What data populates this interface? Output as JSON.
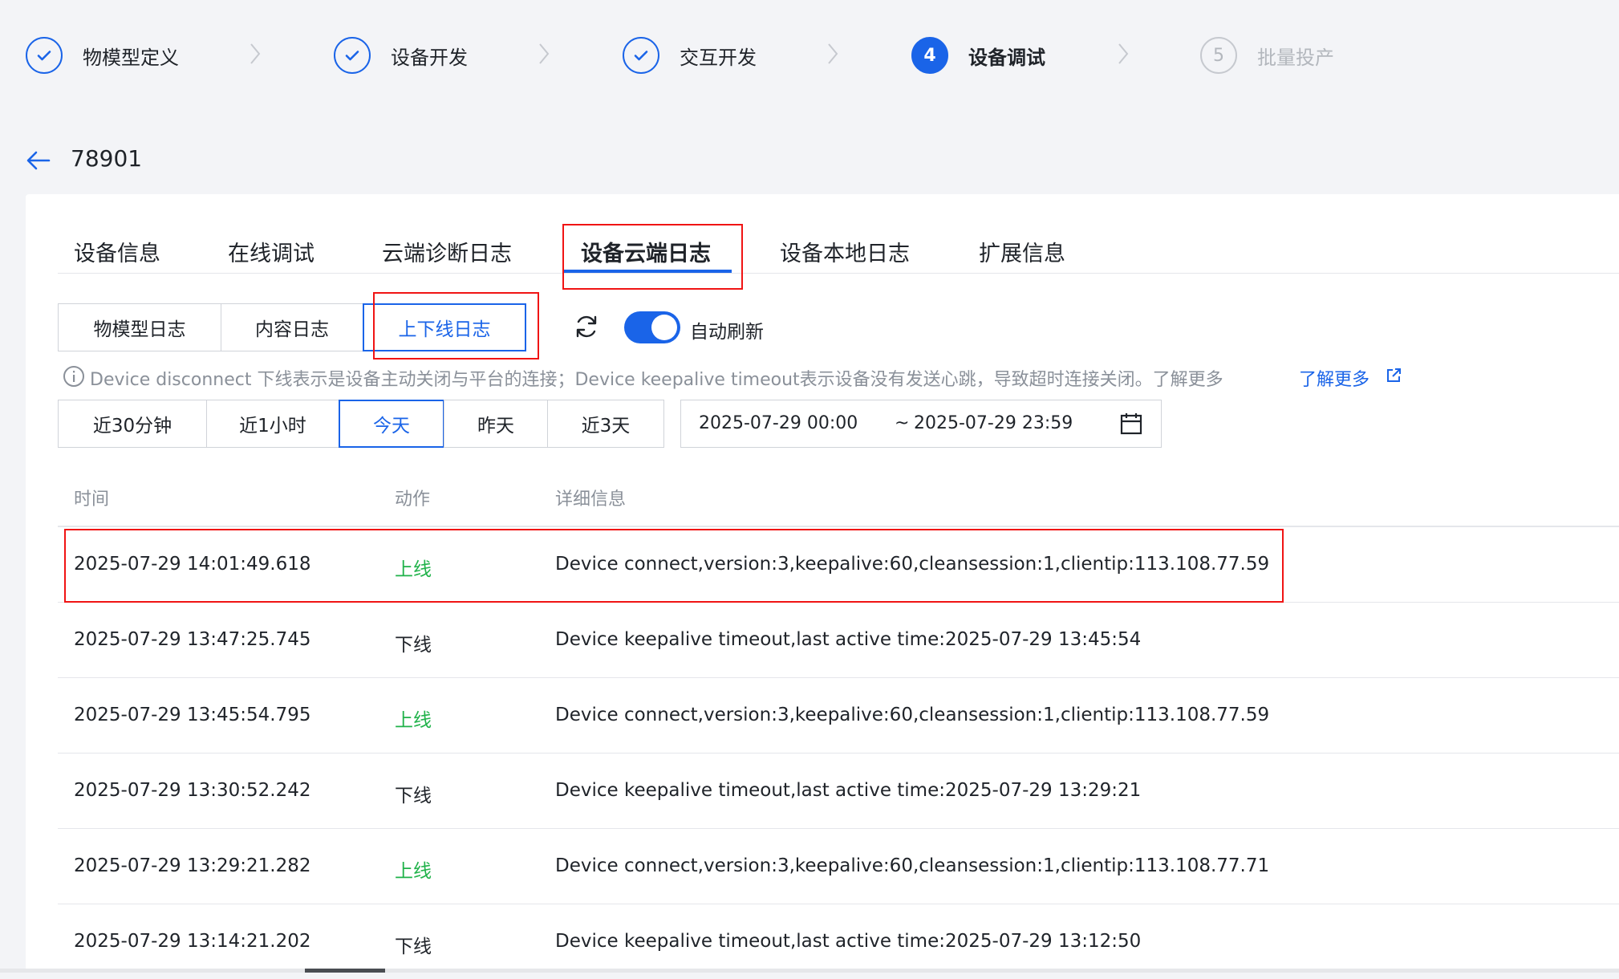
{
  "steps": [
    {
      "label": "物模型定义",
      "state": "done"
    },
    {
      "label": "设备开发",
      "state": "done"
    },
    {
      "label": "交互开发",
      "state": "done"
    },
    {
      "label": "设备调试",
      "state": "active",
      "number": "4"
    },
    {
      "label": "批量投产",
      "state": "pending",
      "number": "5"
    }
  ],
  "header": {
    "device_id": "78901"
  },
  "main_tabs": [
    {
      "label": "设备信息"
    },
    {
      "label": "在线调试"
    },
    {
      "label": "云端诊断日志"
    },
    {
      "label": "设备云端日志",
      "active": true
    },
    {
      "label": "设备本地日志"
    },
    {
      "label": "扩展信息"
    }
  ],
  "log_types": [
    {
      "label": "物模型日志"
    },
    {
      "label": "内容日志"
    },
    {
      "label": "上下线日志",
      "active": true
    }
  ],
  "auto_refresh": {
    "label": "自动刷新",
    "on": true
  },
  "info": {
    "text": "Device disconnect 下线表示是设备主动关闭与平台的连接；Device keepalive timeout表示设备没有发送心跳，导致超时连接关闭。了解更多",
    "link": "了解更多"
  },
  "time_ranges": [
    {
      "label": "近30分钟"
    },
    {
      "label": "近1小时"
    },
    {
      "label": "今天",
      "active": true
    },
    {
      "label": "昨天"
    },
    {
      "label": "近3天"
    }
  ],
  "date_range": {
    "start": "2025-07-29 00:00",
    "separator": "~",
    "end": "2025-07-29 23:59"
  },
  "table": {
    "columns": [
      "时间",
      "动作",
      "详细信息"
    ],
    "rows": [
      {
        "time": "2025-07-29 14:01:49.618",
        "action": "上线",
        "detail": "Device connect,version:3,keepalive:60,cleansession:1,clientip:113.108.77.59"
      },
      {
        "time": "2025-07-29 13:47:25.745",
        "action": "下线",
        "detail": "Device keepalive timeout,last active time:2025-07-29 13:45:54"
      },
      {
        "time": "2025-07-29 13:45:54.795",
        "action": "上线",
        "detail": "Device connect,version:3,keepalive:60,cleansession:1,clientip:113.108.77.59"
      },
      {
        "time": "2025-07-29 13:30:52.242",
        "action": "下线",
        "detail": "Device keepalive timeout,last active time:2025-07-29 13:29:21"
      },
      {
        "time": "2025-07-29 13:29:21.282",
        "action": "上线",
        "detail": "Device connect,version:3,keepalive:60,cleansession:1,clientip:113.108.77.71"
      },
      {
        "time": "2025-07-29 13:14:21.202",
        "action": "下线",
        "detail": "Device keepalive timeout,last active time:2025-07-29 13:12:50"
      }
    ]
  },
  "colors": {
    "primary": "#1a64e8",
    "online": "#20b24a",
    "highlight": "#f01414"
  }
}
